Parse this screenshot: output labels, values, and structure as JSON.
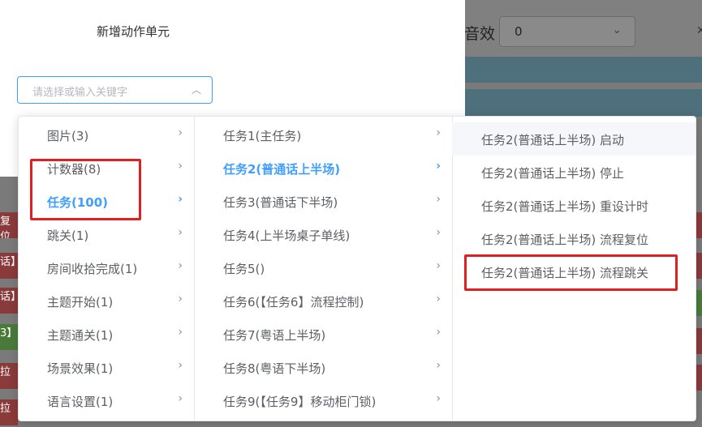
{
  "background": {
    "label_partial": "音效",
    "select_value": "0",
    "left_fragments": [
      "复位",
      "话】",
      "话】",
      "3】",
      "拉",
      "拉"
    ]
  },
  "dialog": {
    "title": "新增动作单元",
    "cascader_placeholder": "请选择或输入关键字"
  },
  "cascader": {
    "level1": [
      "图片(3)",
      "计数器(8)",
      "任务(100)",
      "跳关(1)",
      "房间收拾完成(1)",
      "主题开始(1)",
      "主题通关(1)",
      "场景效果(1)",
      "语言设置(1)"
    ],
    "level1_active": "任务(100)",
    "level2": [
      "任务1(主任务)",
      "任务2(普通话上半场)",
      "任务3(普通话下半场)",
      "任务4(上半场桌子单线)",
      "任务5()",
      "任务6(【任务6】流程控制)",
      "任务7(粤语上半场)",
      "任务8(粤语下半场)",
      "任务9(【任务9】移动柜门锁)"
    ],
    "level2_active": "任务2(普通话上半场)",
    "level3": [
      "任务2(普通话上半场) 启动",
      "任务2(普通话上半场) 停止",
      "任务2(普通话上半场) 重设计时",
      "任务2(普通话上半场) 流程复位",
      "任务2(普通话上半场) 流程跳关"
    ],
    "level3_highlighted": "任务2(普通话上半场) 流程跳关"
  },
  "colors": {
    "accent": "#409eff",
    "annotation": "#e02020"
  }
}
